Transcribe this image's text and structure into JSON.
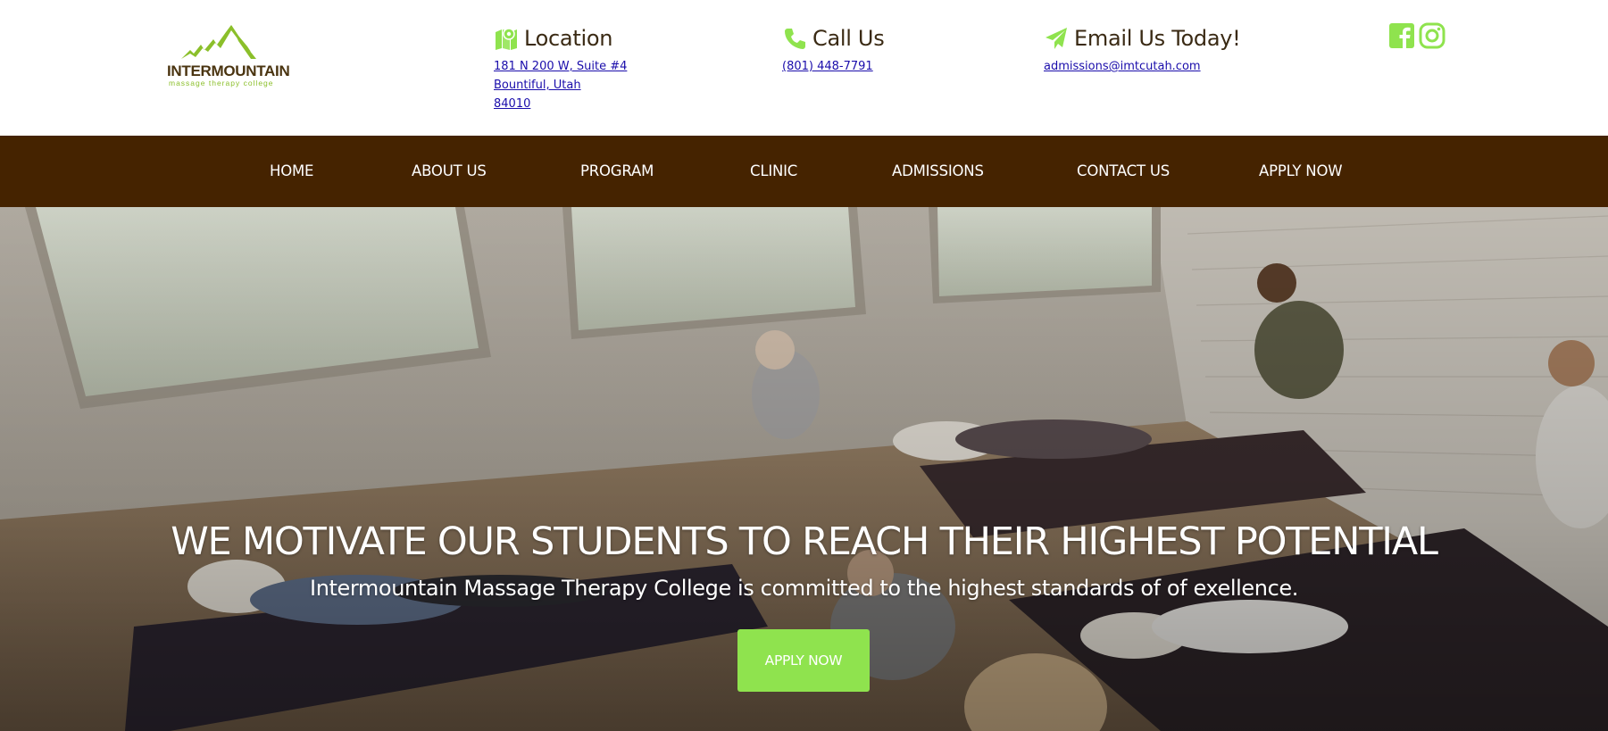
{
  "brand": {
    "name": "INTERMOUNTAIN",
    "tagline": "massage therapy college",
    "accent_color": "#8fe34e",
    "nav_color": "#452300"
  },
  "contact": {
    "location": {
      "title": "Location",
      "icon": "map-icon",
      "lines": [
        "181 N 200 W, Suite #4",
        "Bountiful, Utah",
        "84010"
      ]
    },
    "call": {
      "title": "Call Us",
      "icon": "phone-icon",
      "phone": "(801) 448-7791"
    },
    "email": {
      "title": "Email Us Today!",
      "icon": "paper-plane-icon",
      "address": "admissions@imtcutah.com"
    }
  },
  "social": [
    "facebook-icon",
    "instagram-icon"
  ],
  "nav": {
    "items": [
      "HOME",
      "ABOUT US",
      "PROGRAM",
      "CLINIC",
      "ADMISSIONS",
      "CONTACT US",
      "APPLY NOW"
    ]
  },
  "hero": {
    "title": "WE MOTIVATE OUR STUDENTS TO REACH THEIR HIGHEST POTENTIAL",
    "subtitle": "Intermountain Massage Therapy College is committed to the highest standards of of exellence.",
    "button_label": "APPLY NOW"
  }
}
